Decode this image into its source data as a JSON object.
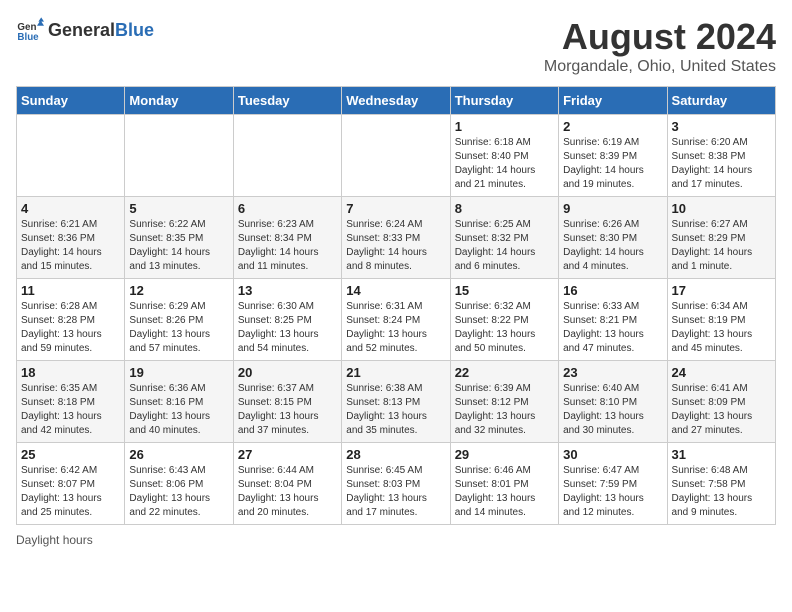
{
  "logo": {
    "general": "General",
    "blue": "Blue"
  },
  "header": {
    "month": "August 2024",
    "location": "Morgandale, Ohio, United States"
  },
  "days_of_week": [
    "Sunday",
    "Monday",
    "Tuesday",
    "Wednesday",
    "Thursday",
    "Friday",
    "Saturday"
  ],
  "footer": {
    "note": "Daylight hours"
  },
  "weeks": [
    [
      {
        "day": "",
        "sunrise": "",
        "sunset": "",
        "daylight": ""
      },
      {
        "day": "",
        "sunrise": "",
        "sunset": "",
        "daylight": ""
      },
      {
        "day": "",
        "sunrise": "",
        "sunset": "",
        "daylight": ""
      },
      {
        "day": "",
        "sunrise": "",
        "sunset": "",
        "daylight": ""
      },
      {
        "day": "1",
        "sunrise": "Sunrise: 6:18 AM",
        "sunset": "Sunset: 8:40 PM",
        "daylight": "Daylight: 14 hours and 21 minutes."
      },
      {
        "day": "2",
        "sunrise": "Sunrise: 6:19 AM",
        "sunset": "Sunset: 8:39 PM",
        "daylight": "Daylight: 14 hours and 19 minutes."
      },
      {
        "day": "3",
        "sunrise": "Sunrise: 6:20 AM",
        "sunset": "Sunset: 8:38 PM",
        "daylight": "Daylight: 14 hours and 17 minutes."
      }
    ],
    [
      {
        "day": "4",
        "sunrise": "Sunrise: 6:21 AM",
        "sunset": "Sunset: 8:36 PM",
        "daylight": "Daylight: 14 hours and 15 minutes."
      },
      {
        "day": "5",
        "sunrise": "Sunrise: 6:22 AM",
        "sunset": "Sunset: 8:35 PM",
        "daylight": "Daylight: 14 hours and 13 minutes."
      },
      {
        "day": "6",
        "sunrise": "Sunrise: 6:23 AM",
        "sunset": "Sunset: 8:34 PM",
        "daylight": "Daylight: 14 hours and 11 minutes."
      },
      {
        "day": "7",
        "sunrise": "Sunrise: 6:24 AM",
        "sunset": "Sunset: 8:33 PM",
        "daylight": "Daylight: 14 hours and 8 minutes."
      },
      {
        "day": "8",
        "sunrise": "Sunrise: 6:25 AM",
        "sunset": "Sunset: 8:32 PM",
        "daylight": "Daylight: 14 hours and 6 minutes."
      },
      {
        "day": "9",
        "sunrise": "Sunrise: 6:26 AM",
        "sunset": "Sunset: 8:30 PM",
        "daylight": "Daylight: 14 hours and 4 minutes."
      },
      {
        "day": "10",
        "sunrise": "Sunrise: 6:27 AM",
        "sunset": "Sunset: 8:29 PM",
        "daylight": "Daylight: 14 hours and 1 minute."
      }
    ],
    [
      {
        "day": "11",
        "sunrise": "Sunrise: 6:28 AM",
        "sunset": "Sunset: 8:28 PM",
        "daylight": "Daylight: 13 hours and 59 minutes."
      },
      {
        "day": "12",
        "sunrise": "Sunrise: 6:29 AM",
        "sunset": "Sunset: 8:26 PM",
        "daylight": "Daylight: 13 hours and 57 minutes."
      },
      {
        "day": "13",
        "sunrise": "Sunrise: 6:30 AM",
        "sunset": "Sunset: 8:25 PM",
        "daylight": "Daylight: 13 hours and 54 minutes."
      },
      {
        "day": "14",
        "sunrise": "Sunrise: 6:31 AM",
        "sunset": "Sunset: 8:24 PM",
        "daylight": "Daylight: 13 hours and 52 minutes."
      },
      {
        "day": "15",
        "sunrise": "Sunrise: 6:32 AM",
        "sunset": "Sunset: 8:22 PM",
        "daylight": "Daylight: 13 hours and 50 minutes."
      },
      {
        "day": "16",
        "sunrise": "Sunrise: 6:33 AM",
        "sunset": "Sunset: 8:21 PM",
        "daylight": "Daylight: 13 hours and 47 minutes."
      },
      {
        "day": "17",
        "sunrise": "Sunrise: 6:34 AM",
        "sunset": "Sunset: 8:19 PM",
        "daylight": "Daylight: 13 hours and 45 minutes."
      }
    ],
    [
      {
        "day": "18",
        "sunrise": "Sunrise: 6:35 AM",
        "sunset": "Sunset: 8:18 PM",
        "daylight": "Daylight: 13 hours and 42 minutes."
      },
      {
        "day": "19",
        "sunrise": "Sunrise: 6:36 AM",
        "sunset": "Sunset: 8:16 PM",
        "daylight": "Daylight: 13 hours and 40 minutes."
      },
      {
        "day": "20",
        "sunrise": "Sunrise: 6:37 AM",
        "sunset": "Sunset: 8:15 PM",
        "daylight": "Daylight: 13 hours and 37 minutes."
      },
      {
        "day": "21",
        "sunrise": "Sunrise: 6:38 AM",
        "sunset": "Sunset: 8:13 PM",
        "daylight": "Daylight: 13 hours and 35 minutes."
      },
      {
        "day": "22",
        "sunrise": "Sunrise: 6:39 AM",
        "sunset": "Sunset: 8:12 PM",
        "daylight": "Daylight: 13 hours and 32 minutes."
      },
      {
        "day": "23",
        "sunrise": "Sunrise: 6:40 AM",
        "sunset": "Sunset: 8:10 PM",
        "daylight": "Daylight: 13 hours and 30 minutes."
      },
      {
        "day": "24",
        "sunrise": "Sunrise: 6:41 AM",
        "sunset": "Sunset: 8:09 PM",
        "daylight": "Daylight: 13 hours and 27 minutes."
      }
    ],
    [
      {
        "day": "25",
        "sunrise": "Sunrise: 6:42 AM",
        "sunset": "Sunset: 8:07 PM",
        "daylight": "Daylight: 13 hours and 25 minutes."
      },
      {
        "day": "26",
        "sunrise": "Sunrise: 6:43 AM",
        "sunset": "Sunset: 8:06 PM",
        "daylight": "Daylight: 13 hours and 22 minutes."
      },
      {
        "day": "27",
        "sunrise": "Sunrise: 6:44 AM",
        "sunset": "Sunset: 8:04 PM",
        "daylight": "Daylight: 13 hours and 20 minutes."
      },
      {
        "day": "28",
        "sunrise": "Sunrise: 6:45 AM",
        "sunset": "Sunset: 8:03 PM",
        "daylight": "Daylight: 13 hours and 17 minutes."
      },
      {
        "day": "29",
        "sunrise": "Sunrise: 6:46 AM",
        "sunset": "Sunset: 8:01 PM",
        "daylight": "Daylight: 13 hours and 14 minutes."
      },
      {
        "day": "30",
        "sunrise": "Sunrise: 6:47 AM",
        "sunset": "Sunset: 7:59 PM",
        "daylight": "Daylight: 13 hours and 12 minutes."
      },
      {
        "day": "31",
        "sunrise": "Sunrise: 6:48 AM",
        "sunset": "Sunset: 7:58 PM",
        "daylight": "Daylight: 13 hours and 9 minutes."
      }
    ]
  ]
}
